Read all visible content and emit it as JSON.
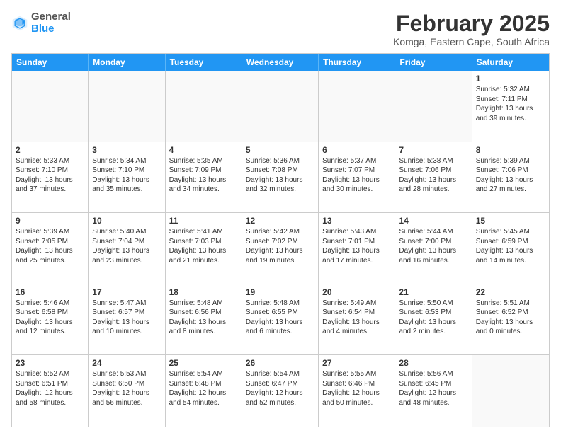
{
  "header": {
    "logo": {
      "line1": "General",
      "line2": "Blue"
    },
    "title": "February 2025",
    "subtitle": "Komga, Eastern Cape, South Africa"
  },
  "days_of_week": [
    "Sunday",
    "Monday",
    "Tuesday",
    "Wednesday",
    "Thursday",
    "Friday",
    "Saturday"
  ],
  "weeks": [
    [
      {
        "day": "",
        "empty": true
      },
      {
        "day": "",
        "empty": true
      },
      {
        "day": "",
        "empty": true
      },
      {
        "day": "",
        "empty": true
      },
      {
        "day": "",
        "empty": true
      },
      {
        "day": "",
        "empty": true
      },
      {
        "day": "1",
        "sunrise": "5:32 AM",
        "sunset": "7:11 PM",
        "daylight": "13 hours and 39 minutes."
      }
    ],
    [
      {
        "day": "2",
        "sunrise": "5:33 AM",
        "sunset": "7:10 PM",
        "daylight": "13 hours and 37 minutes."
      },
      {
        "day": "3",
        "sunrise": "5:34 AM",
        "sunset": "7:10 PM",
        "daylight": "13 hours and 35 minutes."
      },
      {
        "day": "4",
        "sunrise": "5:35 AM",
        "sunset": "7:09 PM",
        "daylight": "13 hours and 34 minutes."
      },
      {
        "day": "5",
        "sunrise": "5:36 AM",
        "sunset": "7:08 PM",
        "daylight": "13 hours and 32 minutes."
      },
      {
        "day": "6",
        "sunrise": "5:37 AM",
        "sunset": "7:07 PM",
        "daylight": "13 hours and 30 minutes."
      },
      {
        "day": "7",
        "sunrise": "5:38 AM",
        "sunset": "7:06 PM",
        "daylight": "13 hours and 28 minutes."
      },
      {
        "day": "8",
        "sunrise": "5:39 AM",
        "sunset": "7:06 PM",
        "daylight": "13 hours and 27 minutes."
      }
    ],
    [
      {
        "day": "9",
        "sunrise": "5:39 AM",
        "sunset": "7:05 PM",
        "daylight": "13 hours and 25 minutes."
      },
      {
        "day": "10",
        "sunrise": "5:40 AM",
        "sunset": "7:04 PM",
        "daylight": "13 hours and 23 minutes."
      },
      {
        "day": "11",
        "sunrise": "5:41 AM",
        "sunset": "7:03 PM",
        "daylight": "13 hours and 21 minutes."
      },
      {
        "day": "12",
        "sunrise": "5:42 AM",
        "sunset": "7:02 PM",
        "daylight": "13 hours and 19 minutes."
      },
      {
        "day": "13",
        "sunrise": "5:43 AM",
        "sunset": "7:01 PM",
        "daylight": "13 hours and 17 minutes."
      },
      {
        "day": "14",
        "sunrise": "5:44 AM",
        "sunset": "7:00 PM",
        "daylight": "13 hours and 16 minutes."
      },
      {
        "day": "15",
        "sunrise": "5:45 AM",
        "sunset": "6:59 PM",
        "daylight": "13 hours and 14 minutes."
      }
    ],
    [
      {
        "day": "16",
        "sunrise": "5:46 AM",
        "sunset": "6:58 PM",
        "daylight": "13 hours and 12 minutes."
      },
      {
        "day": "17",
        "sunrise": "5:47 AM",
        "sunset": "6:57 PM",
        "daylight": "13 hours and 10 minutes."
      },
      {
        "day": "18",
        "sunrise": "5:48 AM",
        "sunset": "6:56 PM",
        "daylight": "13 hours and 8 minutes."
      },
      {
        "day": "19",
        "sunrise": "5:48 AM",
        "sunset": "6:55 PM",
        "daylight": "13 hours and 6 minutes."
      },
      {
        "day": "20",
        "sunrise": "5:49 AM",
        "sunset": "6:54 PM",
        "daylight": "13 hours and 4 minutes."
      },
      {
        "day": "21",
        "sunrise": "5:50 AM",
        "sunset": "6:53 PM",
        "daylight": "13 hours and 2 minutes."
      },
      {
        "day": "22",
        "sunrise": "5:51 AM",
        "sunset": "6:52 PM",
        "daylight": "13 hours and 0 minutes."
      }
    ],
    [
      {
        "day": "23",
        "sunrise": "5:52 AM",
        "sunset": "6:51 PM",
        "daylight": "12 hours and 58 minutes."
      },
      {
        "day": "24",
        "sunrise": "5:53 AM",
        "sunset": "6:50 PM",
        "daylight": "12 hours and 56 minutes."
      },
      {
        "day": "25",
        "sunrise": "5:54 AM",
        "sunset": "6:48 PM",
        "daylight": "12 hours and 54 minutes."
      },
      {
        "day": "26",
        "sunrise": "5:54 AM",
        "sunset": "6:47 PM",
        "daylight": "12 hours and 52 minutes."
      },
      {
        "day": "27",
        "sunrise": "5:55 AM",
        "sunset": "6:46 PM",
        "daylight": "12 hours and 50 minutes."
      },
      {
        "day": "28",
        "sunrise": "5:56 AM",
        "sunset": "6:45 PM",
        "daylight": "12 hours and 48 minutes."
      },
      {
        "day": "",
        "empty": true
      }
    ]
  ]
}
